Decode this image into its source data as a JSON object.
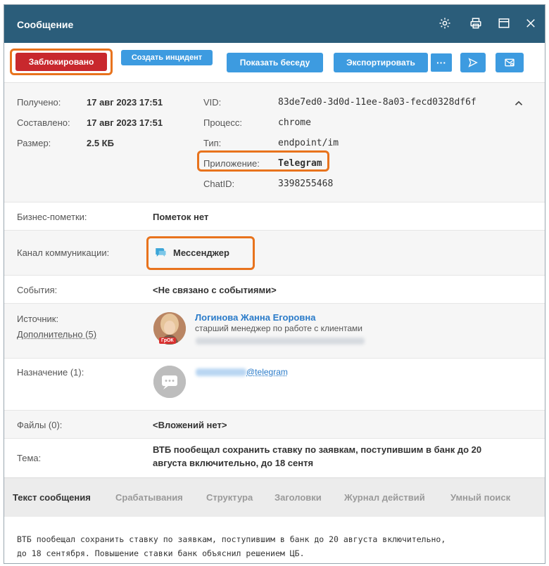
{
  "window": {
    "title": "Сообщение"
  },
  "toolbar": {
    "blocked_label": "Заблокировано",
    "incident_label": "Создать инцидент",
    "show_conversation_label": "Показать беседу",
    "export_label": "Экспортировать",
    "more_label": "···"
  },
  "meta": {
    "received_label": "Получено:",
    "received_value": "17 авг 2023 17:51",
    "composed_label": "Составлено:",
    "composed_value": "17 авг 2023 17:51",
    "size_label": "Размер:",
    "size_value": "2.5 КБ",
    "vid_label": "VID:",
    "vid_value": "83de7ed0-3d0d-11ee-8a03-fecd0328df6f",
    "process_label": "Процесс:",
    "process_value": "chrome",
    "type_label": "Тип:",
    "type_value": "endpoint/im",
    "app_label": "Приложение:",
    "app_value": "Telegram",
    "chatid_label": "ChatID:",
    "chatid_value": "3398255468"
  },
  "rows": {
    "business_label": "Бизнес-пометки:",
    "business_value": "Пометок нет",
    "channel_label": "Канал коммуникации:",
    "channel_value": "Мессенджер",
    "events_label": "События:",
    "events_value": "<Не связано с событиями>",
    "source_label": "Источник:",
    "source_more": "Дополнительно (5)",
    "source_name": "Логинова Жанна Егоровна",
    "source_role": "старший менеджер по работе с клиентами",
    "source_badge": "ГрОК",
    "dest_label": "Назначение (1):",
    "dest_value": "@telegram",
    "files_label": "Файлы (0):",
    "files_value": "<Вложений нет>",
    "subject_label": "Тема:",
    "subject_value_1": "ВТБ пообещал сохранить ставку по заявкам, поступившим в банк до 20",
    "subject_value_2": "августа включительно, до 18 сентя"
  },
  "tabs": [
    "Текст сообщения",
    "Срабатывания",
    "Структура",
    "Заголовки",
    "Журнал действий",
    "Умный поиск"
  ],
  "message": {
    "line1": "ВТБ пообещал сохранить ставку по заявкам, поступившим в банк до 20 августа включительно,",
    "line2": "до 18 сентября. Повышение ставки банк объяснил решением ЦБ."
  },
  "colors": {
    "titlebar": "#2b5d7a",
    "blocked": "#c8282d",
    "accent_blue": "#3d9be0",
    "highlight": "#e8731d",
    "link": "#2a7bc9"
  },
  "icons": [
    "gear-icon",
    "print-icon",
    "window-icon",
    "close-icon",
    "send-icon",
    "mail-settings-icon",
    "chevron-up-icon",
    "chat-bubble-icon"
  ]
}
